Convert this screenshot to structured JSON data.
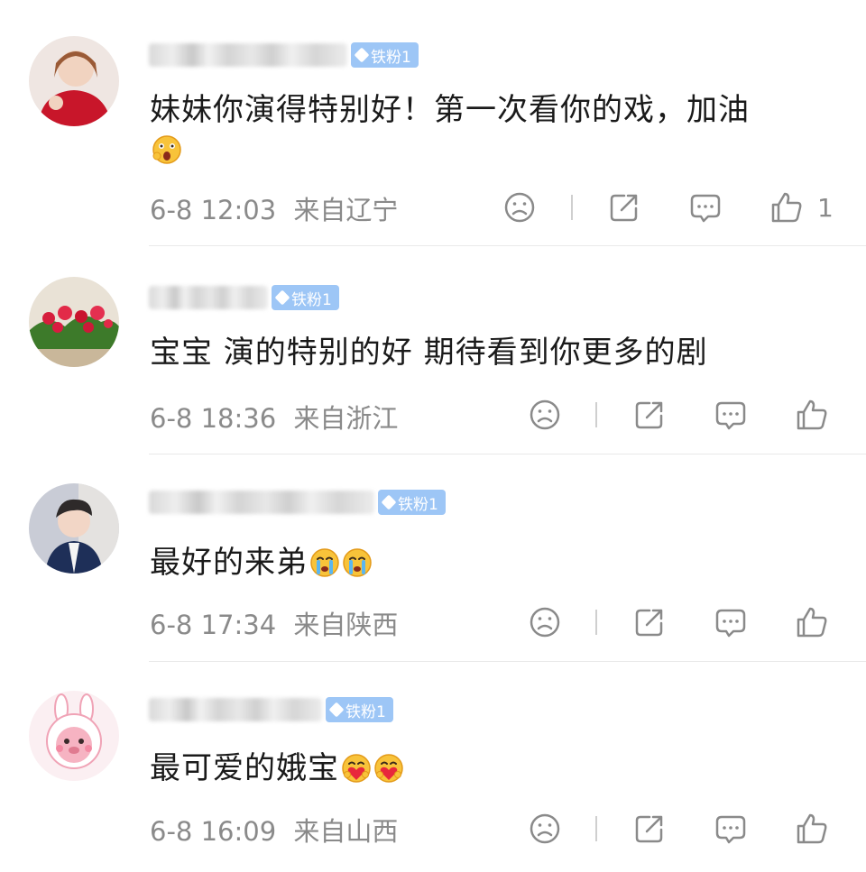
{
  "badge_label": "铁粉1",
  "comments": [
    {
      "text": "妹妹你演得特别好！第一次看你的戏，加油",
      "time": "6-8 12:03",
      "location": "来自辽宁",
      "likes": "1",
      "avatar": "girl-red-sweater",
      "emoji": [
        "surprised-face"
      ]
    },
    {
      "text": "宝宝 演的特别的好 期待看到你更多的剧",
      "time": "6-8 18:36",
      "location": "来自浙江",
      "likes": "",
      "avatar": "red-flowers",
      "emoji": []
    },
    {
      "text": "最好的来弟",
      "time": "6-8 17:34",
      "location": "来自陕西",
      "likes": "",
      "avatar": "boy-portrait",
      "emoji": [
        "crying-face",
        "crying-face"
      ]
    },
    {
      "text": "最可爱的娥宝",
      "time": "6-8 16:09",
      "location": "来自山西",
      "likes": "",
      "avatar": "pink-bunny-cartoon",
      "emoji": [
        "heart-hug-face",
        "heart-hug-face"
      ]
    }
  ],
  "icons": [
    "dislike-face-icon",
    "share-icon",
    "reply-icon",
    "like-thumb-icon"
  ],
  "colors": {
    "badge": "#9dc6f6",
    "meta": "#8a8a8a",
    "text": "#1a1a1a"
  }
}
